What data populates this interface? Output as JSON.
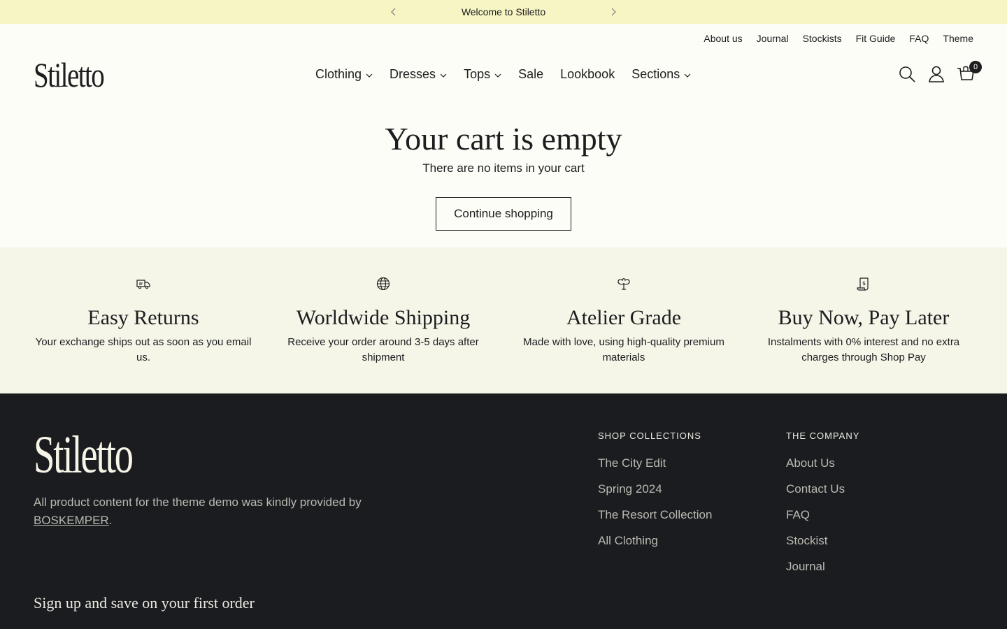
{
  "announcement": {
    "text": "Welcome to Stiletto"
  },
  "utility_nav": [
    "About us",
    "Journal",
    "Stockists",
    "Fit Guide",
    "FAQ",
    "Theme"
  ],
  "brand": {
    "name": "Stiletto"
  },
  "main_nav": [
    {
      "label": "Clothing",
      "dropdown": true
    },
    {
      "label": "Dresses",
      "dropdown": true
    },
    {
      "label": "Tops",
      "dropdown": true
    },
    {
      "label": "Sale",
      "dropdown": false
    },
    {
      "label": "Lookbook",
      "dropdown": false
    },
    {
      "label": "Sections",
      "dropdown": true
    }
  ],
  "cart": {
    "count": "0"
  },
  "empty_cart": {
    "title": "Your cart is empty",
    "subtitle": "There are no items in your cart",
    "button": "Continue shopping"
  },
  "features": [
    {
      "icon": "truck-icon",
      "title": "Easy Returns",
      "text": "Your exchange ships out as soon as you email us."
    },
    {
      "icon": "globe-icon",
      "title": "Worldwide Shipping",
      "text": "Receive your order around 3-5 days after shipment"
    },
    {
      "icon": "plant-icon",
      "title": "Atelier Grade",
      "text": "Made with love, using high-quality premium materials"
    },
    {
      "icon": "receipt-icon",
      "title": "Buy Now, Pay Later",
      "text": "Instalments with 0% interest and no extra charges through Shop Pay"
    }
  ],
  "footer": {
    "credit_text": "All product content for the theme demo was kindly provided by",
    "credit_link": "BOSKEMPER",
    "credit_end": ".",
    "columns": [
      {
        "heading": "SHOP COLLECTIONS",
        "links": [
          "The City Edit",
          "Spring 2024",
          "The Resort Collection",
          "All Clothing"
        ]
      },
      {
        "heading": "THE COMPANY",
        "links": [
          "About Us",
          "Contact Us",
          "FAQ",
          "Stockist",
          "Journal"
        ]
      }
    ],
    "signup_title": "Sign up and save on your first order"
  },
  "colors": {
    "announcement_bg": "#f7f5c4",
    "features_bg": "#f5f5e8",
    "footer_bg": "#1b1c1f",
    "text": "#1c1d1f"
  }
}
